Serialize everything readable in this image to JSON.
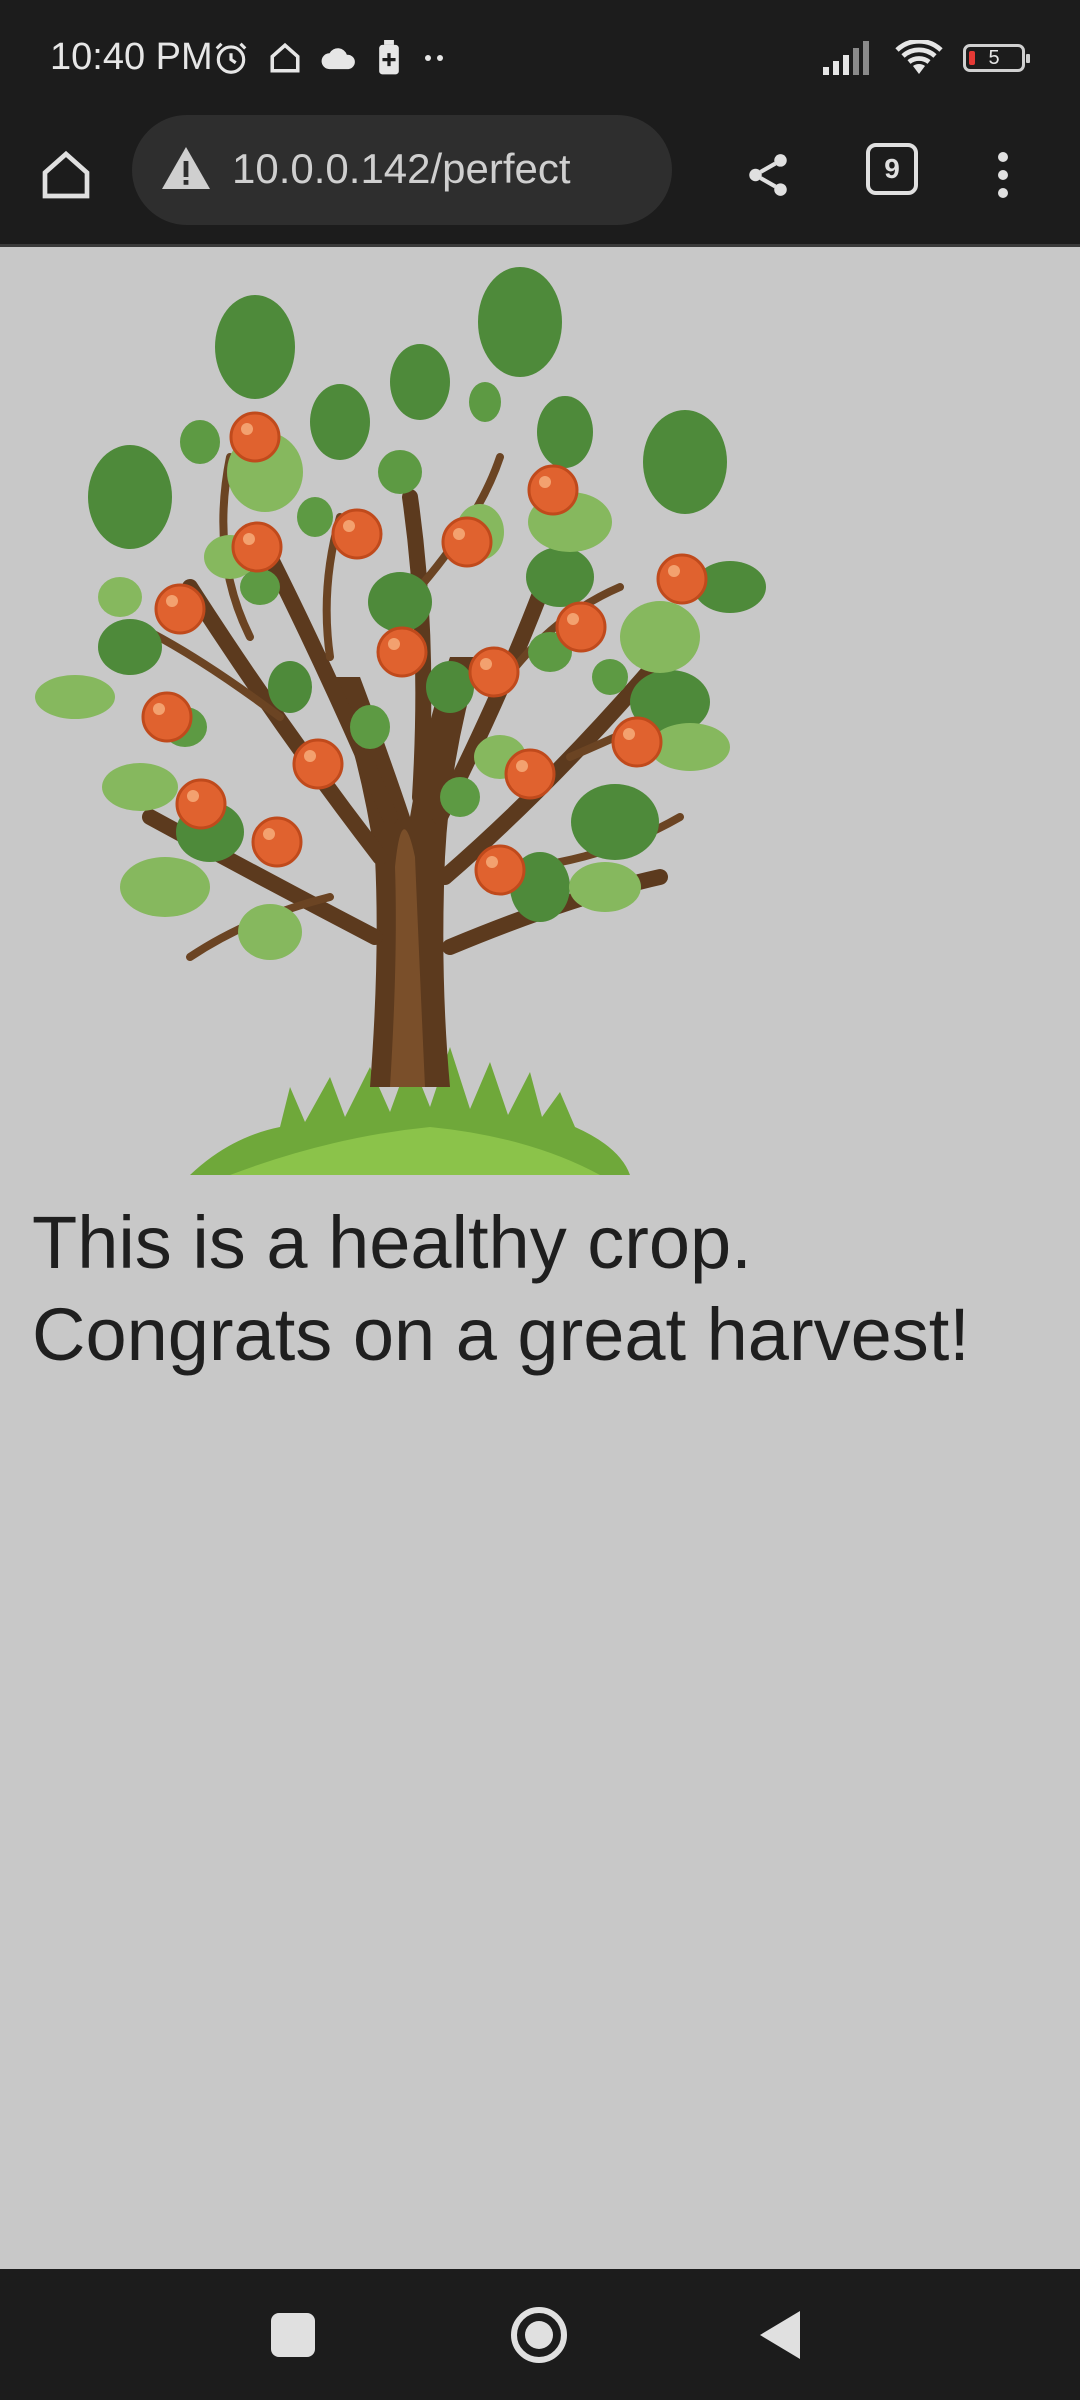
{
  "status_bar": {
    "time": "10:40 PM",
    "icons": [
      "alarm-icon",
      "home-status-icon",
      "cloud-icon",
      "battery-saver-icon",
      "more-dots-icon"
    ],
    "signal": "signal-icon",
    "wifi": "wifi-icon",
    "battery_level": "5",
    "battery_color": "#e53935"
  },
  "toolbar": {
    "url": "10.0.0.142/perfect",
    "security_icon": "warning-icon",
    "tab_count": "9"
  },
  "content": {
    "message": "This is a healthy crop. Congrats on a great harvest!",
    "illustration": "apple-tree-illustration"
  },
  "colors": {
    "page_bg": "#c8c8c8",
    "chrome_bg": "#1c1c1c",
    "leaf_dark": "#4e8a3a",
    "leaf_light": "#86b85e",
    "fruit": "#e0622f",
    "trunk": "#5c3a1e"
  }
}
